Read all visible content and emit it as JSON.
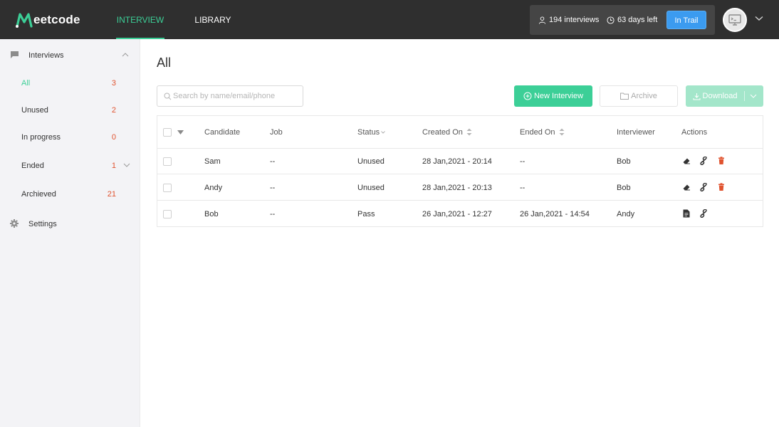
{
  "header": {
    "logo_text": "eetcode",
    "logo_mark": "M",
    "tabs": [
      {
        "label": "INTERVIEW",
        "active": true
      },
      {
        "label": "LIBRARY",
        "active": false
      }
    ],
    "stats": {
      "interviews": "194 interviews",
      "days_left": "63 days left",
      "trail_button": "In Trail"
    }
  },
  "sidebar": {
    "interviews_label": "Interviews",
    "items": [
      {
        "label": "All",
        "count": "3",
        "active": true
      },
      {
        "label": "Unused",
        "count": "2"
      },
      {
        "label": "In progress",
        "count": "0"
      },
      {
        "label": "Ended",
        "count": "1"
      },
      {
        "label": "Archieved",
        "count": "21"
      }
    ],
    "settings_label": "Settings"
  },
  "main": {
    "title": "All",
    "search_placeholder": "Search by name/email/phone",
    "new_interview": "New Interview",
    "archive": "Archive",
    "download": "Download"
  },
  "table": {
    "columns": [
      "Candidate",
      "Job",
      "Status",
      "Created On",
      "Ended On",
      "Interviewer",
      "Actions"
    ],
    "rows": [
      {
        "candidate": "Sam",
        "job": "--",
        "status": "Unused",
        "created": "28 Jan,2021 - 20:14",
        "ended": "--",
        "interviewer": "Bob"
      },
      {
        "candidate": "Andy",
        "job": "--",
        "status": "Unused",
        "created": "28 Jan,2021 - 20:13",
        "ended": "--",
        "interviewer": "Bob"
      },
      {
        "candidate": "Bob",
        "job": "--",
        "status": "Pass",
        "created": "26 Jan,2021 - 12:27",
        "ended": "26 Jan,2021 - 14:54",
        "interviewer": "Andy"
      }
    ]
  },
  "colors": {
    "accent": "#3ccf97",
    "count": "#e0532f",
    "topbar": "#2f2f2f",
    "trail_button": "#3b9bf0",
    "delete_icon": "#e0532f"
  }
}
